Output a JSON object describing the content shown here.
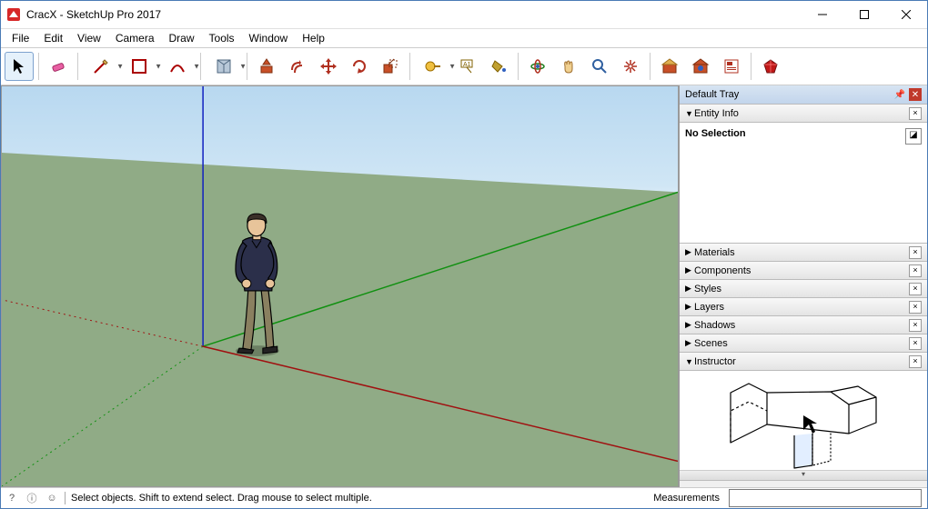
{
  "title": "CracX - SketchUp Pro 2017",
  "menu": [
    "File",
    "Edit",
    "View",
    "Camera",
    "Draw",
    "Tools",
    "Window",
    "Help"
  ],
  "tray": {
    "title": "Default Tray",
    "panels": [
      {
        "label": "Entity Info",
        "expanded": true,
        "body": "No Selection"
      },
      {
        "label": "Materials",
        "expanded": false
      },
      {
        "label": "Components",
        "expanded": false
      },
      {
        "label": "Styles",
        "expanded": false
      },
      {
        "label": "Layers",
        "expanded": false
      },
      {
        "label": "Shadows",
        "expanded": false
      },
      {
        "label": "Scenes",
        "expanded": false
      },
      {
        "label": "Instructor",
        "expanded": true
      }
    ]
  },
  "status": {
    "hint": "Select objects. Shift to extend select. Drag mouse to select multiple.",
    "meas_label": "Measurements"
  },
  "tools": [
    "select",
    "eraser",
    "pencil",
    "pencil-dd",
    "rect",
    "rect-dd",
    "arc",
    "arc-dd",
    "pushpull",
    "offset",
    "move",
    "rotate",
    "scale",
    "tape",
    "tape-dd",
    "text",
    "paint",
    "orbit",
    "pan",
    "zoom",
    "zoom-extents",
    "3d-warehouse",
    "ext-warehouse",
    "layout",
    "ruby"
  ]
}
